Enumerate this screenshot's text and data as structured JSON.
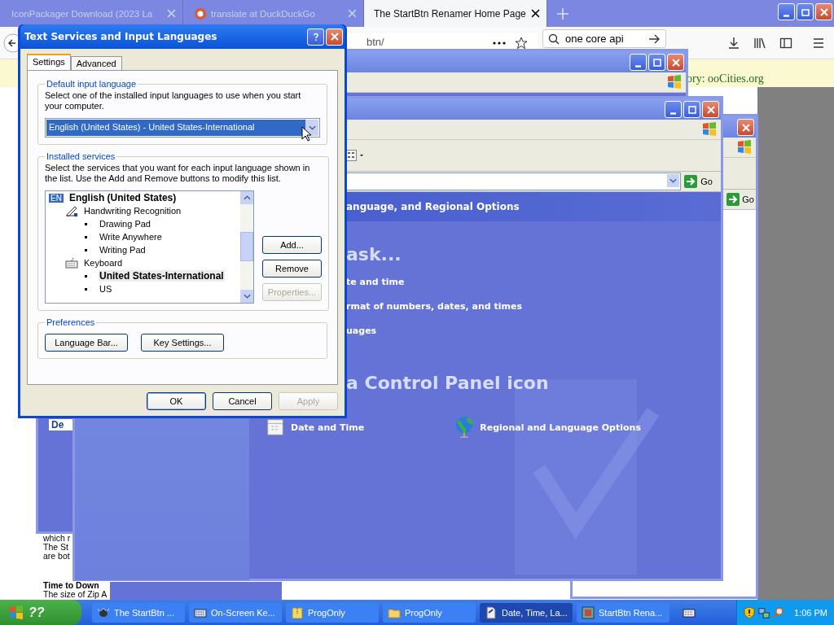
{
  "browser": {
    "tabs": [
      {
        "title": "IconPackager Download (2023 La",
        "selected": false
      },
      {
        "title": "translate at DuckDuckGo",
        "selected": false
      },
      {
        "title": "The StartBtn Renamer Home Page",
        "selected": true
      }
    ],
    "url": "btn/",
    "search": "one core api",
    "notice": "ory: ooCities.org",
    "page_lines": [
      "which r",
      "The St",
      "are bot"
    ],
    "page_heading": "Time to Down",
    "page_line": "The size of Zip A"
  },
  "back_window": {
    "label": "De"
  },
  "right_window": {
    "go": "Go"
  },
  "control_panel": {
    "header": "anguage, and Regional Options",
    "go": "Go",
    "task_heading": "ask...",
    "tasks": [
      "te and time",
      "rmat of numbers, dates, and times",
      "uages"
    ],
    "icon_heading": "a Control Panel icon",
    "icons": [
      {
        "label": "Date and Time",
        "kind": "clock"
      },
      {
        "label": "Regional and Language Options",
        "kind": "globe"
      }
    ]
  },
  "dialog": {
    "title": "Text Services and Input Languages",
    "tabs": [
      {
        "label": "Settings",
        "selected": true
      },
      {
        "label": "Advanced",
        "selected": false
      }
    ],
    "default_group": {
      "label": "Default input language",
      "description": "Select one of the installed input languages to use when you start your computer.",
      "value": "English (United States) - United States-International"
    },
    "services_group": {
      "label": "Installed services",
      "description": "Select the services that you want for each input language shown in the list. Use the Add and Remove buttons to modify this list.",
      "tree": [
        {
          "label": "English (United States)",
          "kind": "language",
          "badge": "EN",
          "children": [
            {
              "label": "Handwriting Recognition",
              "kind": "pen",
              "children": [
                {
                  "label": "Drawing Pad",
                  "kind": "leaf",
                  "selected": false
                },
                {
                  "label": "Write Anywhere",
                  "kind": "leaf",
                  "selected": false
                },
                {
                  "label": "Writing Pad",
                  "kind": "leaf",
                  "selected": false
                }
              ]
            },
            {
              "label": "Keyboard",
              "kind": "keyboard",
              "children": [
                {
                  "label": "United States-International",
                  "kind": "leaf",
                  "selected": true
                },
                {
                  "label": "US",
                  "kind": "leaf",
                  "selected": false
                }
              ]
            }
          ]
        }
      ],
      "buttons": [
        {
          "label": "Add...",
          "disabled": false
        },
        {
          "label": "Remove",
          "disabled": false
        },
        {
          "label": "Properties...",
          "disabled": true
        }
      ]
    },
    "preferences": {
      "label": "Preferences",
      "buttons": [
        "Language Bar...",
        "Key Settings..."
      ]
    },
    "footer_buttons": [
      {
        "label": "OK",
        "disabled": false
      },
      {
        "label": "Cancel",
        "disabled": false
      },
      {
        "label": "Apply",
        "disabled": true
      }
    ]
  },
  "taskbar": {
    "start": "??",
    "items": [
      {
        "label": "The StartBtn ...",
        "kind": "bug",
        "selected": false
      },
      {
        "label": "On-Screen Ke...",
        "kind": "keyboard",
        "selected": false
      },
      {
        "label": "ProgOnly",
        "kind": "zip",
        "selected": false
      },
      {
        "label": "ProgOnly",
        "kind": "folder",
        "selected": false
      },
      {
        "label": "Date, Time, La...",
        "kind": "doc",
        "selected": true
      },
      {
        "label": "StartBtn Rena...",
        "kind": "app",
        "selected": false
      }
    ],
    "clock": "1:06 PM"
  }
}
